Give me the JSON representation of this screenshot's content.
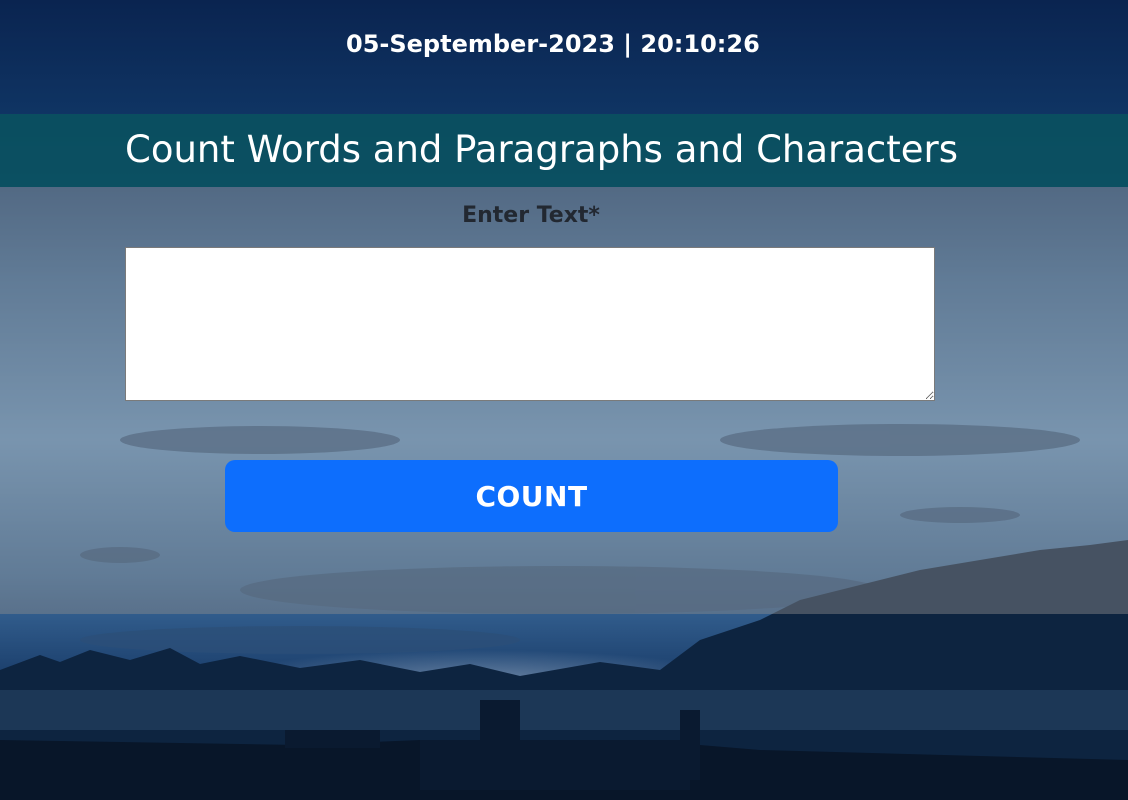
{
  "header": {
    "datetime": "05-September-2023 | 20:10:26"
  },
  "title": {
    "text": "Count Words and Paragraphs and Characters"
  },
  "form": {
    "label": "Enter Text*",
    "textarea_value": "",
    "textarea_placeholder": "",
    "button_label": "COUNT"
  },
  "colors": {
    "title_band": "#0a505f",
    "button": "#0d6efd",
    "label_text": "#222831",
    "sky_top": "#0a2a55",
    "sky_mid": "#5b8ec0"
  }
}
